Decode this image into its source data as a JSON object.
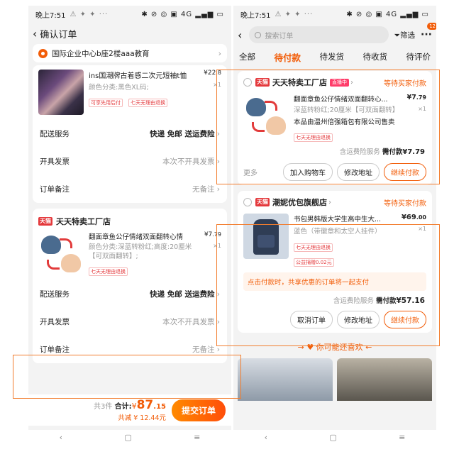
{
  "left": {
    "status_time": "晚上7:51",
    "status_icons_left": "⚠ ✦ ✦ ···",
    "status_icons_right": "✱ ⊘ ◎ ▣ 4G ▂▄▆ ▭",
    "title": "确认订单",
    "address": "国际企业中心b座2楼aaa教育",
    "item1": {
      "title": "ins国潮牌古着感二次元短袖t恤",
      "price": "¥22",
      "price_decimal": ".8",
      "spec": "颜色分类:黑色XL码;",
      "qty": "×1",
      "tags": [
        "可享先用后付",
        "七天无理由退换"
      ]
    },
    "delivery_label": "配送服务",
    "delivery_value": "快递 免邮 送运费险",
    "invoice_label": "开具发票",
    "invoice_value": "本次不开具发票",
    "remark_label": "订单备注",
    "remark_value": "无备注",
    "store2": {
      "badge": "天猫",
      "name": "天天特卖工厂店"
    },
    "item2": {
      "title": "翻面章鱼公仔情绪双面翻转心情",
      "price": "¥7",
      "price_decimal": ".79",
      "spec": "颜色分类:深蓝转粉红;高度:20厘米【可双面翻转】;",
      "qty": "×1",
      "tags": [
        "七天无理由退换"
      ]
    },
    "delivery_label2": "配送服务",
    "delivery_value2": "快递 免邮 送运费险",
    "invoice_label2": "开具发票",
    "invoice_value2": "本次不开具发票",
    "remark_label2": "订单备注",
    "remark_value2": "无备注",
    "footer": {
      "count": "共3件",
      "total_label": "合计:",
      "total_currency": "¥",
      "total_int": "87",
      "total_decimal": ".15",
      "discount": "共减 ¥ 12.44元",
      "submit": "提交订单"
    }
  },
  "right": {
    "status_time": "晚上7:51",
    "status_icons_left": "⚠ ✦ ✦ ···",
    "status_icons_right": "✱ ⊘ ◎ ▣ 4G ▂▄▆ ▭",
    "search_placeholder": "搜索订单",
    "filter_label": "筛选",
    "more_badge": "12",
    "tabs": [
      "全部",
      "待付款",
      "待发货",
      "待收货",
      "待评价"
    ],
    "order1": {
      "badge": "天猫",
      "store": "天天特卖工厂店",
      "live": "直播中",
      "status": "等待买家付款",
      "title": "翻面章鱼公仔情绪双面翻转心...",
      "price": "¥7",
      "price_decimal": ".79",
      "spec": "深蓝转粉红;20厘米【可双面翻转】",
      "qty": "×1",
      "seller": "本品由温州倍强箱包有限公司售卖",
      "tag": "七天无理由退换",
      "fee_note": "含运费险服务",
      "pay_label": "需付款",
      "pay_amount": "¥7.79",
      "more": "更多",
      "btn1": "加入购物车",
      "btn2": "修改地址",
      "btn3": "继续付款"
    },
    "order2": {
      "badge": "天猫",
      "store": "潮妮优包旗舰店",
      "status": "等待买家付款",
      "title": "书包男韩版大学生高中生大...",
      "price": "¥69",
      "price_decimal": ".00",
      "spec": "蓝色（带徽章和太空人挂件）",
      "qty": "×1",
      "tags": [
        "七天无理由退换",
        "公益捐赠0.02元"
      ],
      "notice": "点击付款时，共享优惠的订单将一起支付",
      "fee_note": "含运费险服务",
      "pay_label": "需付款",
      "pay_amount": "¥57.16",
      "btn1": "取消订单",
      "btn2": "修改地址",
      "btn3": "继续付款"
    },
    "recommend": "你可能还喜欢"
  },
  "colors": {
    "accent": "#f25d09",
    "red": "#e4393c",
    "annotation": "#f27d2e"
  }
}
